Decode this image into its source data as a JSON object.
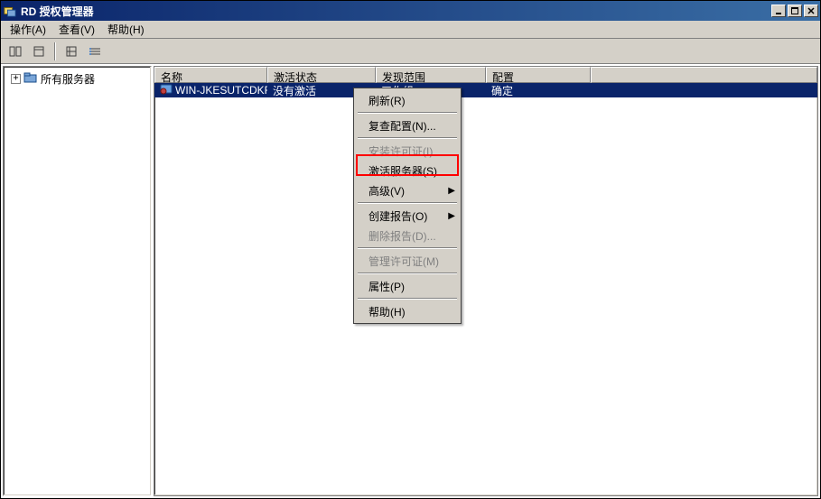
{
  "titlebar": {
    "title": "RD 授权管理器"
  },
  "menubar": {
    "action": "操作(A)",
    "view": "查看(V)",
    "help": "帮助(H)"
  },
  "tree": {
    "root": "所有服务器"
  },
  "list": {
    "columns": {
      "name": "名称",
      "activation": "激活状态",
      "scope": "发现范围",
      "config": "配置"
    },
    "row": {
      "name": "WIN-JKESUTCDKFE",
      "activation": "没有激活",
      "scope": "工作组",
      "config": "确定"
    }
  },
  "context_menu": {
    "refresh": "刷新(R)",
    "review_config": "复查配置(N)...",
    "install_license": "安装许可证(I)",
    "activate_server": "激活服务器(S)",
    "advanced": "高级(V)",
    "create_report": "创建报告(O)",
    "delete_report": "删除报告(D)...",
    "manage_license": "管理许可证(M)",
    "properties": "属性(P)",
    "help": "帮助(H)"
  }
}
